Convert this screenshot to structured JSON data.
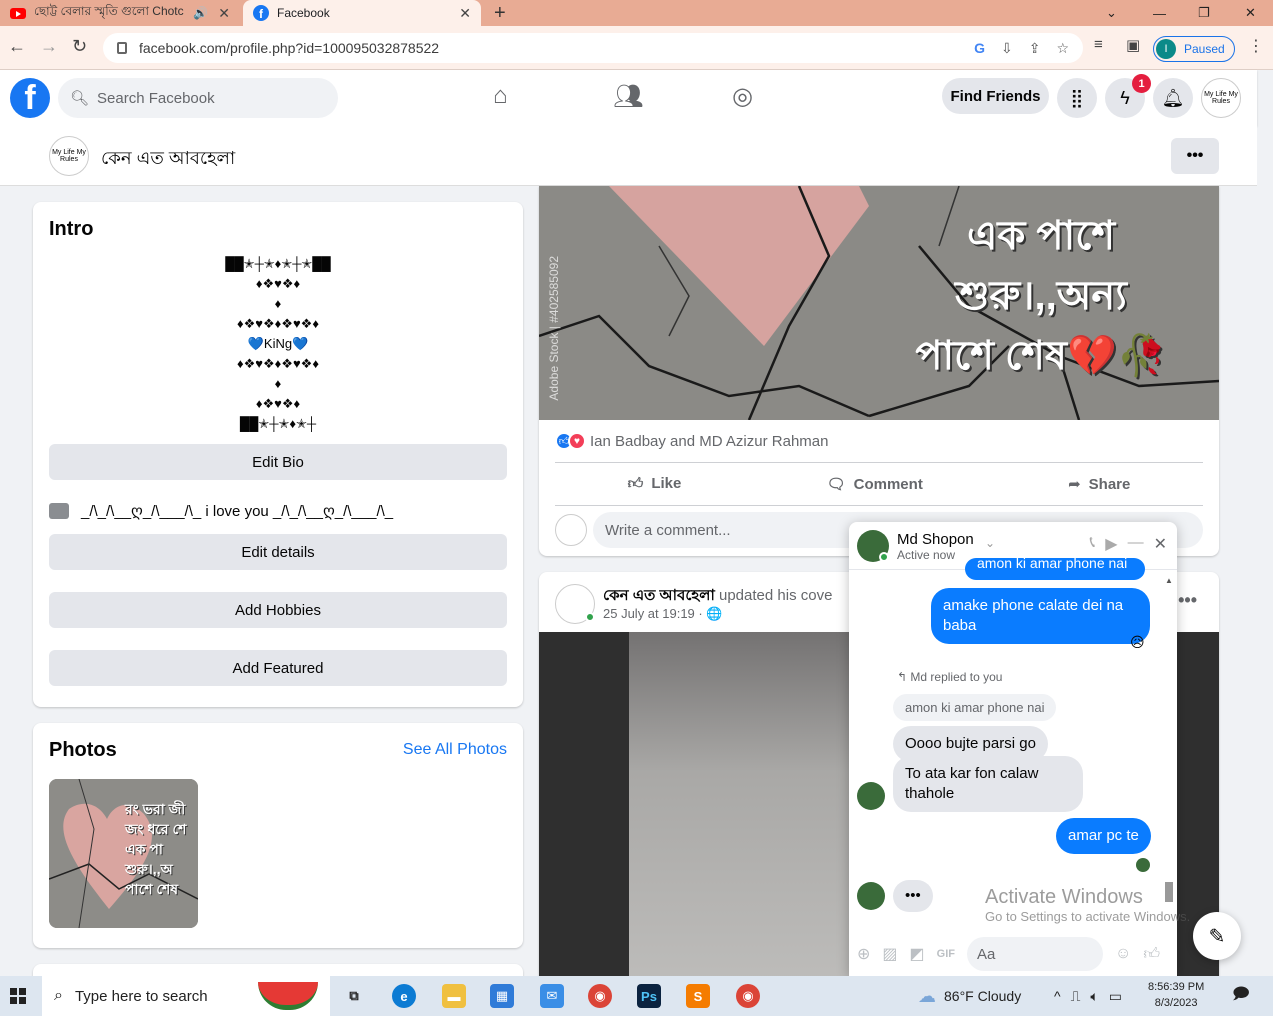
{
  "browser": {
    "tabs": [
      {
        "title": "ছোট্ট বেলার স্মৃতি গুলো Chotc",
        "favicon": "youtube-icon",
        "audio": true
      },
      {
        "title": "Facebook",
        "favicon": "facebook-icon",
        "active": true
      }
    ],
    "url": "facebook.com/profile.php?id=100095032878522",
    "profile_initial": "I",
    "profile_status": "Paused"
  },
  "facebook": {
    "search_placeholder": "Search Facebook",
    "find_friends": "Find Friends",
    "messenger_badge": "1",
    "profile_name": "কেন এত আবহেলা",
    "avatar_text": "My Life My Rules"
  },
  "intro": {
    "title": "Intro",
    "bio": "██✭┼✭♦✭┼✭██\n♦❖♥❖♦\n♦\n♦❖♥❖♦❖♥❖♦\n💙KiNg💙\n♦❖♥❖♦❖♥❖♦\n♦\n♦❖♥❖♦\n██✭┼✭♦✭┼",
    "edit_bio": "Edit Bio",
    "work_text": "_/\\_/\\__ღ_/\\___/\\_ i love you _/\\_/\\__ღ_/\\___/\\_",
    "edit_details": "Edit details",
    "add_hobbies": "Add Hobbies",
    "add_featured": "Add Featured"
  },
  "photos": {
    "title": "Photos",
    "see_all": "See All Photos",
    "thumb_text": "রং ভরা জী জং ধরে শে এক পা শুরু।,,অ পাশে শেষ"
  },
  "post1": {
    "image_text_lines": [
      "এক পাশে",
      "শুরু।,,অন্য",
      "পাশে শেষ💔🥀"
    ],
    "watermark": "Adobe Stock | #402585092",
    "reactions": "Ian Badbay and MD Azizur Rahman",
    "like": "Like",
    "comment": "Comment",
    "share": "Share",
    "comment_placeholder": "Write a comment..."
  },
  "post2": {
    "author": "কেন এত আবহেলা",
    "updated": "updated his cove",
    "date": "25 July at 19:19 · 🌐"
  },
  "chat": {
    "name": "Md Shopon",
    "status": "Active now",
    "msg_cut": "amon ki amar phone nai",
    "msg1": "amake phone calate dei na baba",
    "reply_label": "Md replied to you",
    "quoted": "amon ki amar phone nai",
    "msg2": "Oooo bujte parsi go",
    "msg3": "To ata kar fon calaw thahole",
    "msg4": "amar pc te",
    "input_placeholder": "Aa"
  },
  "watermark": {
    "line1": "Activate Windows",
    "line2": "Go to Settings to activate Windows."
  },
  "taskbar": {
    "search": "Type here to search",
    "weather": "86°F  Cloudy",
    "time": "8:56:39 PM",
    "date": "8/3/2023"
  },
  "colors": {
    "accent": "#1877f2",
    "messenger_bubble": "#0a7cff",
    "tabstrip": "#e8ab94"
  }
}
